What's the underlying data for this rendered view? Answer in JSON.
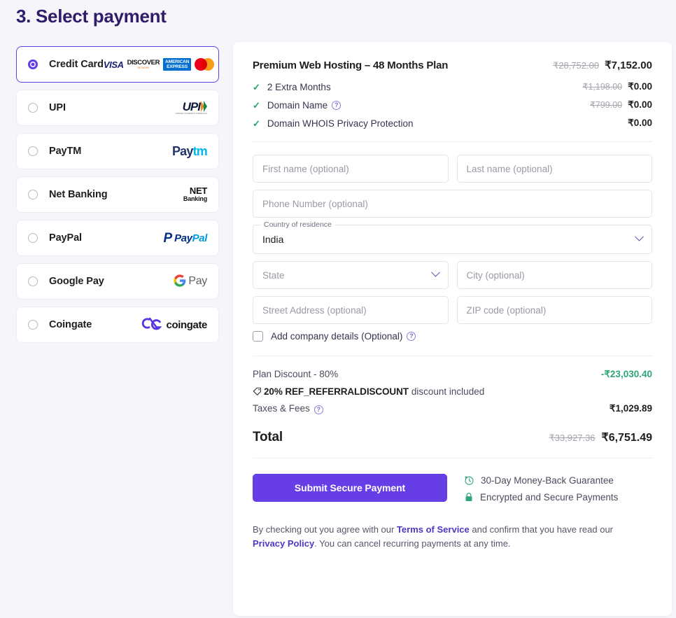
{
  "page": {
    "step_title": "3. Select payment",
    "background_color": "#f5f5fa",
    "accent_color": "#673de6"
  },
  "payment_methods": {
    "items": [
      {
        "id": "credit-card",
        "label": "Credit Card",
        "selected": true,
        "logos": [
          "visa",
          "discover",
          "american-express",
          "mastercard"
        ]
      },
      {
        "id": "upi",
        "label": "UPI",
        "selected": false,
        "logos": [
          "upi"
        ]
      },
      {
        "id": "paytm",
        "label": "PayTM",
        "selected": false,
        "logos": [
          "paytm"
        ]
      },
      {
        "id": "net-banking",
        "label": "Net Banking",
        "selected": false,
        "logos": [
          "net-banking"
        ]
      },
      {
        "id": "paypal",
        "label": "PayPal",
        "selected": false,
        "logos": [
          "paypal"
        ]
      },
      {
        "id": "google-pay",
        "label": "Google Pay",
        "selected": false,
        "logos": [
          "google-pay"
        ]
      },
      {
        "id": "coingate",
        "label": "Coingate",
        "selected": false,
        "logos": [
          "coingate"
        ]
      }
    ],
    "logo_text": {
      "visa": "VISA",
      "discover": "DISCOVER",
      "discover_sub": "NETWORK",
      "amex_line1": "AMERICAN",
      "amex_line2": "EXPRESS",
      "upi": "UPI",
      "upi_sub": "UNIFIED PAYMENTS INTERFACE",
      "paytm_a": "Pay",
      "paytm_b": "tm",
      "netbanking_1": "NET",
      "netbanking_2": "Banking",
      "paypal_mark": "P",
      "paypal_1": "Pay",
      "paypal_2": "Pal",
      "gpay_g": "G",
      "gpay_pay": "Pay",
      "coingate": "coingate"
    }
  },
  "summary": {
    "plan": {
      "name": "Premium Web Hosting – 48 Months Plan",
      "price_old": "₹28,752.00",
      "price_new": "₹7,152.00"
    },
    "features": [
      {
        "name": "2 Extra Months",
        "price_old": "₹1,198.00",
        "price_new": "₹0.00",
        "has_info": false
      },
      {
        "name": "Domain Name",
        "price_old": "₹799.00",
        "price_new": "₹0.00",
        "has_info": true
      },
      {
        "name": "Domain WHOIS Privacy Protection",
        "price_old": "",
        "price_new": "₹0.00",
        "has_info": false
      }
    ]
  },
  "form": {
    "first_name_placeholder": "First name (optional)",
    "last_name_placeholder": "Last name (optional)",
    "phone_placeholder": "Phone Number (optional)",
    "country_label": "Country of residence",
    "country_value": "India",
    "state_placeholder": "State",
    "city_placeholder": "City (optional)",
    "street_placeholder": "Street Address (optional)",
    "zip_placeholder": "ZIP code (optional)",
    "company_checkbox_label": "Add company details (Optional)",
    "company_checked": false
  },
  "totals": {
    "discount_label": "Plan Discount - 80%",
    "discount_value": "-₹23,030.40",
    "coupon_code": "20% REF_REFERRALDISCOUNT",
    "coupon_rest": "discount included",
    "taxes_label": "Taxes & Fees",
    "taxes_value": "₹1,029.89",
    "total_label": "Total",
    "total_old": "₹33,927.36",
    "total_new": "₹6,751.49"
  },
  "cta": {
    "submit_label": "Submit Secure Payment",
    "trust": [
      {
        "icon": "clock-refresh-icon",
        "text": "30-Day Money-Back Guarantee"
      },
      {
        "icon": "lock-icon",
        "text": "Encrypted and Secure Payments"
      }
    ]
  },
  "legal": {
    "part1": "By checking out you agree with our ",
    "link1": "Terms of Service",
    "part2": " and confirm that you have read our ",
    "link2": "Privacy Policy",
    "part3": ". You can cancel recurring payments at any time."
  }
}
